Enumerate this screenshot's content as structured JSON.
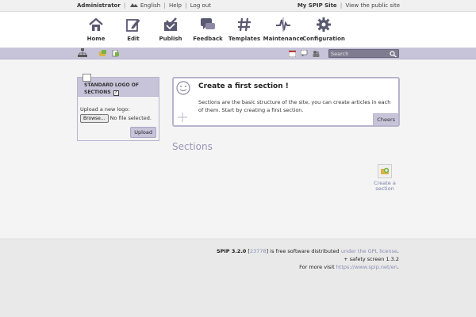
{
  "topbar": {
    "user": "Administrator",
    "language": "English",
    "help": "Help",
    "logout": "Log out",
    "site_name": "My SPIP Site",
    "view_public": "View the public site"
  },
  "nav": {
    "items": [
      {
        "label": "Home",
        "icon": "home-icon"
      },
      {
        "label": "Edit",
        "icon": "pencil-icon"
      },
      {
        "label": "Publish",
        "icon": "checkmark-icon"
      },
      {
        "label": "Feedback",
        "icon": "speech-bubble-icon"
      },
      {
        "label": "Templates",
        "icon": "hash-icon"
      },
      {
        "label": "Maintenance",
        "icon": "pulse-icon"
      },
      {
        "label": "Configuration",
        "icon": "gear-icon"
      }
    ]
  },
  "subbar": {
    "search_placeholder": "Search"
  },
  "logo_box": {
    "title": "STANDARD LOGO OF SECTIONS",
    "help": "?",
    "upload_label": "Upload a new logo:",
    "browse": "Browse...",
    "no_file": "No file selected.",
    "upload_button": "Upload"
  },
  "notice": {
    "title": "Create a first section !",
    "text": "Sections are the basic structure of the site, you can create articles in each of them. Start by creating a first section.",
    "cheers": "Cheers"
  },
  "main": {
    "sections_title": "Sections",
    "create_section": "Create a section"
  },
  "footer": {
    "spip": "SPIP 3.2.0",
    "rev_open": "[",
    "revision": "23778",
    "rev_close": "]",
    "free_text": "is free software distributed",
    "license": "under the GPL license",
    "dot": ".",
    "safety": "+ safety screen 1.3.2",
    "more_visit": "For more visit",
    "url": "https://www.spip.net/en",
    "end": "."
  },
  "colors": {
    "accent": "#c7c4da",
    "accent_dark": "#9a96b6",
    "link": "#8a8bb4"
  }
}
